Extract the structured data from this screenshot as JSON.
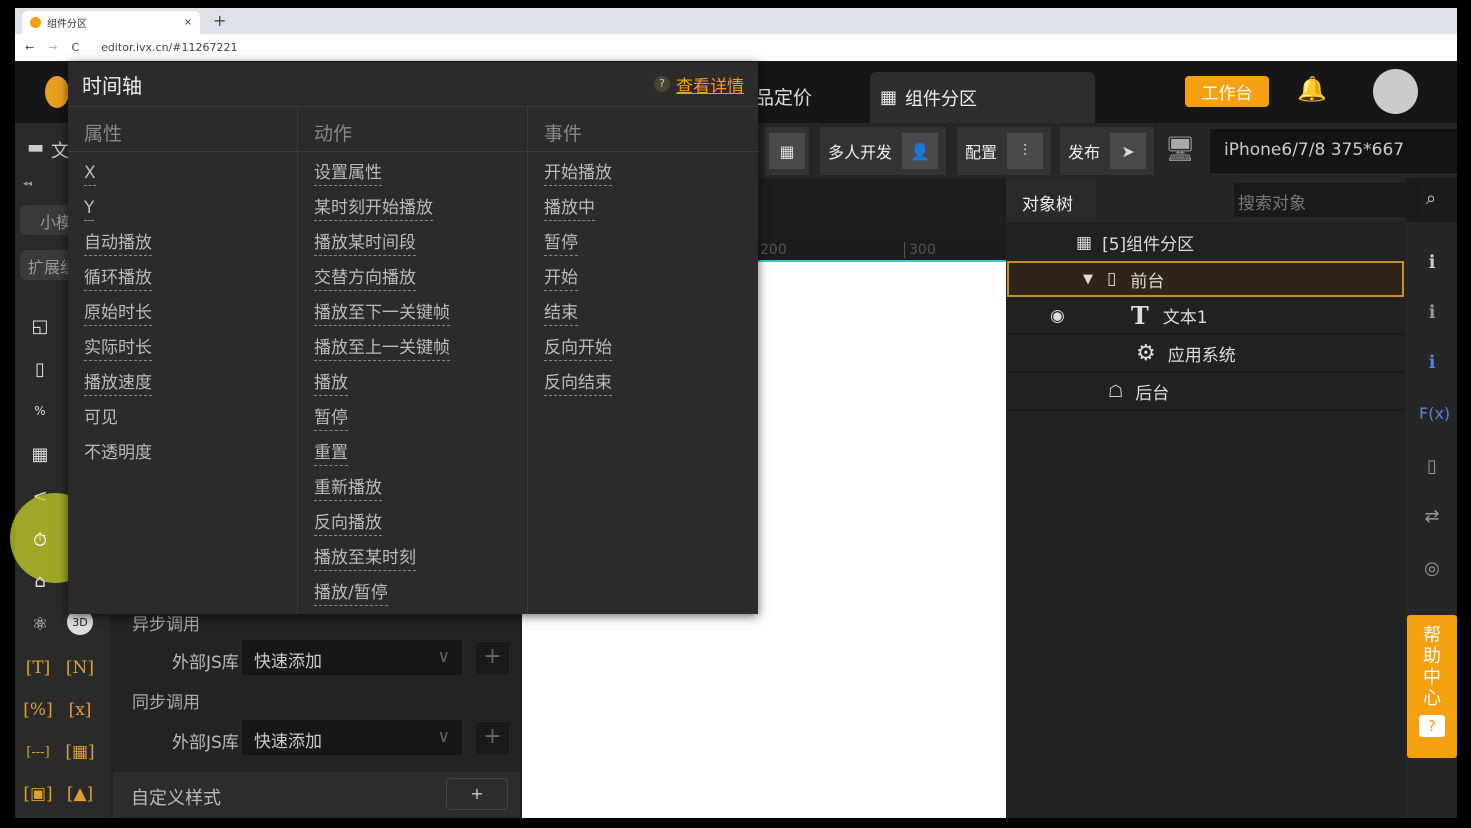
{
  "browser": {
    "tab_title": "组件分区",
    "tab_close": "×",
    "new_tab": "+",
    "url": "editor.ivx.cn/#11267221",
    "back": "←",
    "forward": "→",
    "reload": "C"
  },
  "header": {
    "tab_pricing": "品定价",
    "tab_active": "组件分区",
    "workbench": "工作台"
  },
  "toolbar": {
    "multi_dev": "多人开发",
    "config": "配置",
    "publish": "发布",
    "device": "iPhone6/7/8 375*667"
  },
  "left": {
    "tab_small": "小模",
    "tab_ext": "扩展组",
    "file": "文",
    "bracket_icons": [
      "[T]",
      "[N]",
      "[%]",
      "[x]",
      "[---]",
      "[▦]",
      "[▣]",
      "[▲]"
    ],
    "badge3d": "3D"
  },
  "popup": {
    "title": "时间轴",
    "help_link": "查看详情",
    "columns": [
      {
        "header": "属性",
        "items": [
          "X",
          "Y",
          "自动播放",
          "循环播放",
          "原始时长",
          "实际时长",
          "播放速度",
          "可见",
          "不透明度"
        ]
      },
      {
        "header": "动作",
        "items": [
          "设置属性",
          "某时刻开始播放",
          "播放某时间段",
          "交替方向播放",
          "播放至下一关键帧",
          "播放至上一关键帧",
          "播放",
          "暂停",
          "重置",
          "重新播放",
          "反向播放",
          "播放至某时刻",
          "播放/暂停"
        ]
      },
      {
        "header": "事件",
        "items": [
          "开始播放",
          "播放中",
          "暂停",
          "开始",
          "结束",
          "反向开始",
          "反向结束"
        ]
      }
    ]
  },
  "lpanel": {
    "async": "异步调用",
    "sync": "同步调用",
    "js_label": "外部JS库",
    "quick_add": "快速添加",
    "custom_style": "自定义样式",
    "plus": "+"
  },
  "ruler": {
    "t200": "200",
    "t300": "300"
  },
  "tree": {
    "title": "对象树",
    "search_placeholder": "搜索对象",
    "root": "[5]组件分区",
    "front": "前台",
    "text1": "文本1",
    "appsys": "应用系统",
    "back": "后台"
  },
  "help": {
    "label": "帮助中心",
    "q": "?"
  },
  "colors": {
    "accent": "#f5a00f",
    "bg": "#1c1c1c",
    "popup": "#2b2b2b"
  }
}
